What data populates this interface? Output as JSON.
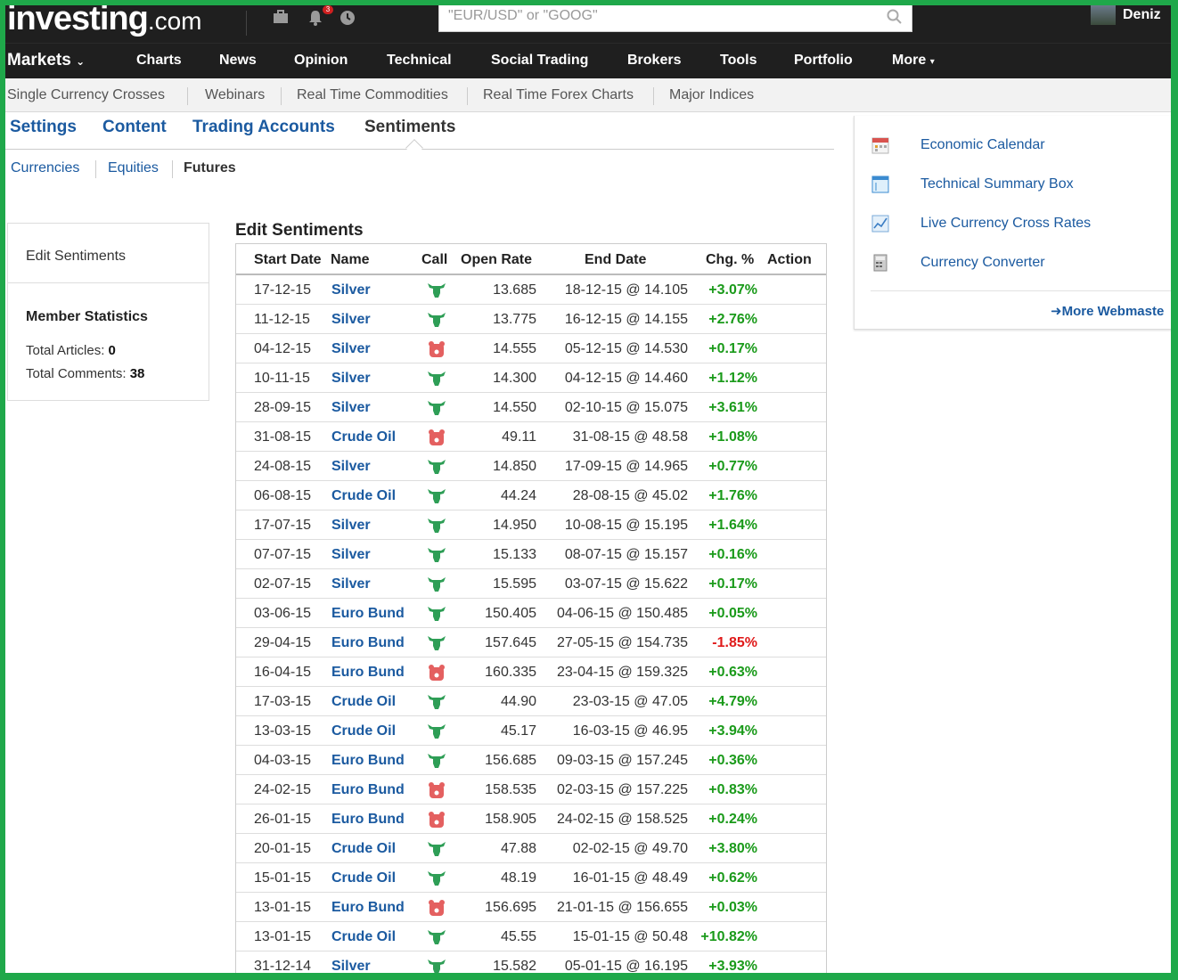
{
  "header": {
    "logo_main": "investing",
    "logo_suffix": ".com",
    "notification_count": "3",
    "search_placeholder": "\"EUR/USD\" or \"GOOG\"",
    "username": "Deniz"
  },
  "main_nav": [
    "Markets",
    "Charts",
    "News",
    "Opinion",
    "Technical",
    "Social Trading",
    "Brokers",
    "Tools",
    "Portfolio",
    "More"
  ],
  "sub_nav": [
    "Single Currency Crosses",
    "Webinars",
    "Real Time Commodities",
    "Real Time Forex Charts",
    "Major Indices"
  ],
  "tabs": [
    "Settings",
    "Content",
    "Trading Accounts",
    "Sentiments"
  ],
  "active_tab": "Sentiments",
  "sub_tabs": [
    "Currencies",
    "Equities",
    "Futures"
  ],
  "active_sub_tab": "Futures",
  "sidebar": {
    "edit_label": "Edit Sentiments",
    "member_stats_title": "Member Statistics",
    "total_articles_label": "Total Articles:",
    "total_articles": "0",
    "total_comments_label": "Total Comments:",
    "total_comments": "38"
  },
  "table": {
    "title": "Edit Sentiments",
    "headers": [
      "Start Date",
      "Name",
      "Call",
      "Open Rate",
      "End Date",
      "Chg. %",
      "Action"
    ],
    "rows": [
      {
        "start": "17-12-15",
        "name": "Silver",
        "call": "bull",
        "open": "13.685",
        "end": "18-12-15 @ 14.105",
        "chg": "+3.07%"
      },
      {
        "start": "11-12-15",
        "name": "Silver",
        "call": "bull",
        "open": "13.775",
        "end": "16-12-15 @ 14.155",
        "chg": "+2.76%"
      },
      {
        "start": "04-12-15",
        "name": "Silver",
        "call": "bear",
        "open": "14.555",
        "end": "05-12-15 @ 14.530",
        "chg": "+0.17%"
      },
      {
        "start": "10-11-15",
        "name": "Silver",
        "call": "bull",
        "open": "14.300",
        "end": "04-12-15 @ 14.460",
        "chg": "+1.12%"
      },
      {
        "start": "28-09-15",
        "name": "Silver",
        "call": "bull",
        "open": "14.550",
        "end": "02-10-15 @ 15.075",
        "chg": "+3.61%"
      },
      {
        "start": "31-08-15",
        "name": "Crude Oil",
        "call": "bear",
        "open": "49.11",
        "end": "31-08-15 @ 48.58",
        "chg": "+1.08%"
      },
      {
        "start": "24-08-15",
        "name": "Silver",
        "call": "bull",
        "open": "14.850",
        "end": "17-09-15 @ 14.965",
        "chg": "+0.77%"
      },
      {
        "start": "06-08-15",
        "name": "Crude Oil",
        "call": "bull",
        "open": "44.24",
        "end": "28-08-15 @ 45.02",
        "chg": "+1.76%"
      },
      {
        "start": "17-07-15",
        "name": "Silver",
        "call": "bull",
        "open": "14.950",
        "end": "10-08-15 @ 15.195",
        "chg": "+1.64%"
      },
      {
        "start": "07-07-15",
        "name": "Silver",
        "call": "bull",
        "open": "15.133",
        "end": "08-07-15 @ 15.157",
        "chg": "+0.16%"
      },
      {
        "start": "02-07-15",
        "name": "Silver",
        "call": "bull",
        "open": "15.595",
        "end": "03-07-15 @ 15.622",
        "chg": "+0.17%"
      },
      {
        "start": "03-06-15",
        "name": "Euro Bund",
        "call": "bull",
        "open": "150.405",
        "end": "04-06-15 @ 150.485",
        "chg": "+0.05%"
      },
      {
        "start": "29-04-15",
        "name": "Euro Bund",
        "call": "bull",
        "open": "157.645",
        "end": "27-05-15 @ 154.735",
        "chg": "-1.85%"
      },
      {
        "start": "16-04-15",
        "name": "Euro Bund",
        "call": "bear",
        "open": "160.335",
        "end": "23-04-15 @ 159.325",
        "chg": "+0.63%"
      },
      {
        "start": "17-03-15",
        "name": "Crude Oil",
        "call": "bull",
        "open": "44.90",
        "end": "23-03-15 @ 47.05",
        "chg": "+4.79%"
      },
      {
        "start": "13-03-15",
        "name": "Crude Oil",
        "call": "bull",
        "open": "45.17",
        "end": "16-03-15 @ 46.95",
        "chg": "+3.94%"
      },
      {
        "start": "04-03-15",
        "name": "Euro Bund",
        "call": "bull",
        "open": "156.685",
        "end": "09-03-15 @ 157.245",
        "chg": "+0.36%"
      },
      {
        "start": "24-02-15",
        "name": "Euro Bund",
        "call": "bear",
        "open": "158.535",
        "end": "02-03-15 @ 157.225",
        "chg": "+0.83%"
      },
      {
        "start": "26-01-15",
        "name": "Euro Bund",
        "call": "bear",
        "open": "158.905",
        "end": "24-02-15 @ 158.525",
        "chg": "+0.24%"
      },
      {
        "start": "20-01-15",
        "name": "Crude Oil",
        "call": "bull",
        "open": "47.88",
        "end": "02-02-15 @ 49.70",
        "chg": "+3.80%"
      },
      {
        "start": "15-01-15",
        "name": "Crude Oil",
        "call": "bull",
        "open": "48.19",
        "end": "16-01-15 @ 48.49",
        "chg": "+0.62%"
      },
      {
        "start": "13-01-15",
        "name": "Euro Bund",
        "call": "bear",
        "open": "156.695",
        "end": "21-01-15 @ 156.655",
        "chg": "+0.03%"
      },
      {
        "start": "13-01-15",
        "name": "Crude Oil",
        "call": "bull",
        "open": "45.55",
        "end": "15-01-15 @ 50.48",
        "chg": "+10.82%"
      },
      {
        "start": "31-12-14",
        "name": "Silver",
        "call": "bull",
        "open": "15.582",
        "end": "05-01-15 @ 16.195",
        "chg": "+3.93%"
      }
    ]
  },
  "right_panel": {
    "links": [
      {
        "label": "Economic Calendar",
        "icon": "calendar-icon"
      },
      {
        "label": "Technical Summary Box",
        "icon": "summary-box-icon"
      },
      {
        "label": "Live Currency Cross Rates",
        "icon": "chart-icon"
      },
      {
        "label": "Currency Converter",
        "icon": "calculator-icon"
      }
    ],
    "more_label": "More Webmaste"
  },
  "colors": {
    "positive": "#1a9a1a",
    "negative": "#e01a1a",
    "link": "#1b5aa0",
    "bull": "#2e9e56",
    "bear": "#e46060",
    "frame": "#1fa84a"
  }
}
